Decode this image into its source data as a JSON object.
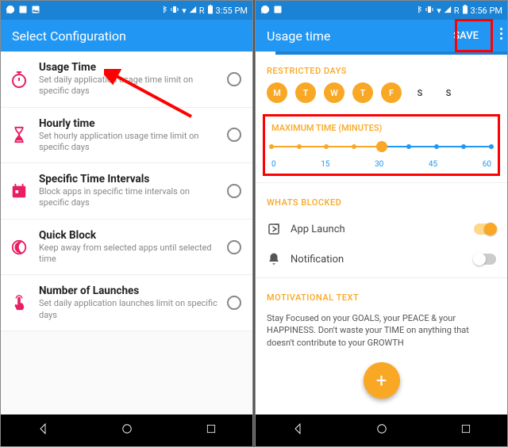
{
  "left": {
    "statusbar": {
      "time": "3:55 PM"
    },
    "appbar_title": "Select Configuration",
    "items": [
      {
        "title": "Usage Time",
        "sub": "Set daily application usage time limit on specific days"
      },
      {
        "title": "Hourly time",
        "sub": "Set hourly application usage time limit on specific days"
      },
      {
        "title": "Specific Time Intervals",
        "sub": "Block apps in specific time intervals on specific days"
      },
      {
        "title": "Quick Block",
        "sub": "Keep away from selected apps until selected time"
      },
      {
        "title": "Number of Launches",
        "sub": "Set daily application launches limit on specific days"
      }
    ]
  },
  "right": {
    "statusbar": {
      "time": "3:56 PM"
    },
    "appbar_title": "Usage time",
    "save_label": "SAVE",
    "restricted_days_label": "RESTRICTED DAYS",
    "days": [
      "M",
      "T",
      "W",
      "T",
      "F",
      "S",
      "S"
    ],
    "max_time_label": "MAXIMUM TIME (MINUTES)",
    "slider_ticks": [
      "0",
      "15",
      "30",
      "45",
      "60"
    ],
    "whats_blocked_label": "WHATS BLOCKED",
    "block_items": [
      {
        "label": "App Launch",
        "on": true
      },
      {
        "label": "Notification",
        "on": false
      }
    ],
    "motiv_label": "MOTIVATIONAL TEXT",
    "motiv_text": "Stay Focused on your GOALS, your PEACE & your HAPPINESS. Don't waste your TIME on anything that doesn't contribute to your GROWTH"
  },
  "shared": {
    "network_label": "R"
  }
}
